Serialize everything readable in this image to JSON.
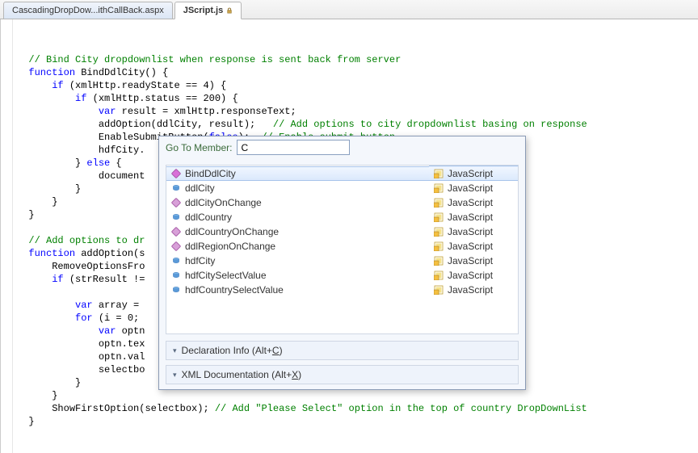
{
  "tabs": [
    {
      "label": "CascadingDropDow...ithCallBack.aspx",
      "active": false,
      "locked": false
    },
    {
      "label": "JScript.js",
      "active": true,
      "locked": true
    }
  ],
  "code": {
    "l1": "// Bind City dropdownlist when response is sent back from server",
    "l2a": "function",
    "l2b": " BindDdlCity() {",
    "l3a": "if",
    "l3b": " (xmlHttp.readyState == 4) {",
    "l4a": "if",
    "l4b": " (xmlHttp.status == 200) {",
    "l5a": "var",
    "l5b": " result = xmlHttp.responseText;",
    "l6a": "addOption(ddlCity, result);   ",
    "l6b": "// Add options to city dropdownlist basing on response",
    "l7a": "EnableSubmitButton(",
    "l7b": "false",
    "l7c": ");  ",
    "l7d": "// Enable submit button",
    "l8": "hdfCity.",
    "l9a": "} ",
    "l9b": "else",
    "l9c": " {",
    "l10": "document",
    "l15": "// Add options to dr",
    "l16a": "function",
    "l16b": " addOption(s",
    "l17": "RemoveOptionsFro",
    "l18a": "if",
    "l18b": " (strResult !=",
    "l20a": "var",
    "l20b": " array = ",
    "l21a": "for",
    "l21b": " (i = 0; ",
    "l22a": "var",
    "l22b": " optn",
    "l23": "optn.tex",
    "l24": "optn.val",
    "l25": "selectbo",
    "l29a": "ShowFirstOption(selectbox); ",
    "l29b": "// Add \"Please Select\" option in the top of country DropDownList"
  },
  "popup": {
    "title": "Go To Member:",
    "input_value": "C",
    "panel1_prefix": "Declaration Info (Alt+",
    "panel1_u": "C",
    "panel1_suffix": ")",
    "panel2_prefix": "XML Documentation (Alt+",
    "panel2_u": "X",
    "panel2_suffix": ")",
    "members": [
      {
        "name": "BindDdlCity",
        "lang": "JavaScript",
        "kind": "method-pub",
        "selected": true
      },
      {
        "name": "ddlCity",
        "lang": "JavaScript",
        "kind": "field",
        "selected": false
      },
      {
        "name": "ddlCityOnChange",
        "lang": "JavaScript",
        "kind": "method-priv",
        "selected": false
      },
      {
        "name": "ddlCountry",
        "lang": "JavaScript",
        "kind": "field",
        "selected": false
      },
      {
        "name": "ddlCountryOnChange",
        "lang": "JavaScript",
        "kind": "method-priv",
        "selected": false
      },
      {
        "name": "ddlRegionOnChange",
        "lang": "JavaScript",
        "kind": "method-priv",
        "selected": false
      },
      {
        "name": "hdfCity",
        "lang": "JavaScript",
        "kind": "field",
        "selected": false
      },
      {
        "name": "hdfCitySelectValue",
        "lang": "JavaScript",
        "kind": "field",
        "selected": false
      },
      {
        "name": "hdfCountrySelectValue",
        "lang": "JavaScript",
        "kind": "field",
        "selected": false
      }
    ]
  }
}
